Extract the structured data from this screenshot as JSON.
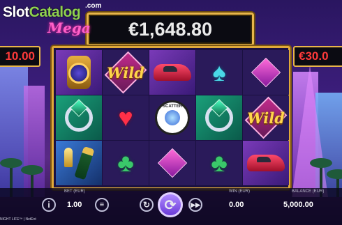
{
  "brand": {
    "name_part1": "Slot",
    "name_part2": "Catalog",
    "tld": ".com",
    "game_sub": "Mega"
  },
  "jackpots": {
    "main": "€1,648.80",
    "left": "10.00",
    "right": "€30.0"
  },
  "reels": [
    [
      "watch",
      "wild",
      "car",
      "spade",
      "diamond"
    ],
    [
      "ring",
      "heart",
      "scatter",
      "ring",
      "wild"
    ],
    [
      "champagne",
      "club",
      "diamond",
      "club",
      "car"
    ]
  ],
  "symbols": {
    "wild_text": "Wild",
    "scatter_text": "SCATTER"
  },
  "controls": {
    "bet_label": "BET (EUR)",
    "bet_value": "1.00",
    "win_label": "WIN (EUR)",
    "win_value": "0.00",
    "balance_label": "BALANCE (EUR)",
    "balance_value": "5,000.00",
    "info_icon": "i",
    "spin_icon": "⟳",
    "auto_icon": "↻",
    "turbo_icon": "▶▶"
  },
  "footer": "NIGHT LIFE™ | NetEnt",
  "colors": {
    "frame_gold": "#e0a93a",
    "jackpot_red": "#ff3a3a",
    "spin_purple": "#8a5aff"
  }
}
